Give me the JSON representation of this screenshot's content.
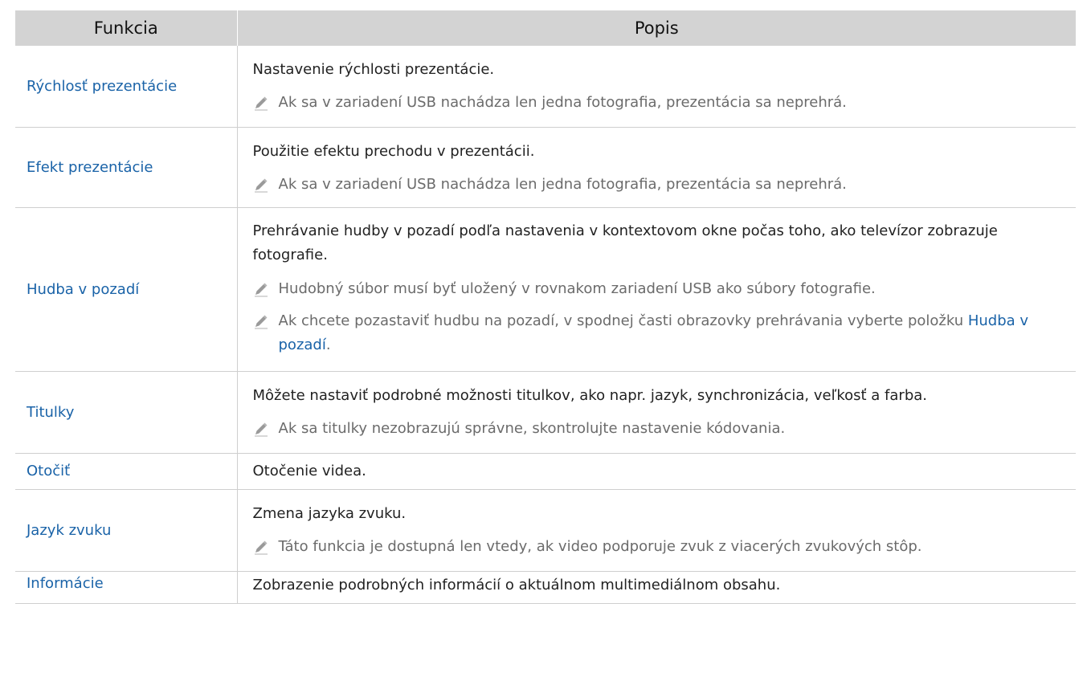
{
  "table": {
    "headers": {
      "function": "Funkcia",
      "description": "Popis"
    },
    "rows": [
      {
        "name": "Rýchlosť prezentácie",
        "description": "Nastavenie rýchlosti prezentácie.",
        "notes": [
          "Ak sa v zariadení USB nachádza len jedna fotografia, prezentácia sa neprehrá."
        ]
      },
      {
        "name": "Efekt prezentácie",
        "description": "Použitie efektu prechodu v prezentácii.",
        "notes": [
          "Ak sa v zariadení USB nachádza len jedna fotografia, prezentácia sa neprehrá."
        ]
      },
      {
        "name": "Hudba v pozadí",
        "description": "Prehrávanie hudby v pozadí podľa nastavenia v kontextovom okne počas toho, ako televízor zobrazuje fotografie.",
        "notes": [
          "Hudobný súbor musí byť uložený v rovnakom zariadení USB ako súbory fotografie.",
          "Ak chcete pozastaviť hudbu na pozadí, v spodnej časti obrazovky prehrávania vyberte položku "
        ],
        "note_link": "Hudba v pozadí",
        "note_suffix": "."
      },
      {
        "name": "Titulky",
        "description": "Môžete nastaviť podrobné možnosti titulkov, ako napr. jazyk, synchronizácia, veľkosť a farba.",
        "notes": [
          "Ak sa titulky nezobrazujú správne, skontrolujte nastavenie kódovania."
        ]
      },
      {
        "name": "Otočiť",
        "description": "Otočenie videa.",
        "notes": []
      },
      {
        "name": "Jazyk zvuku",
        "description": "Zmena jazyka zvuku.",
        "notes": [
          "Táto funkcia je dostupná len vtedy, ak video podporuje zvuk z viacerých zvukových stôp."
        ]
      },
      {
        "name": "Informácie",
        "description": "Zobrazenie podrobných informácií o aktuálnom multimediálnom obsahu.",
        "notes": []
      }
    ]
  },
  "icons": {
    "note_icon": "pencil-icon"
  },
  "colors": {
    "link": "#1a63a8",
    "header_bg": "#d3d3d3",
    "note_text": "#6b6b6b",
    "border": "#cfcfcf"
  }
}
